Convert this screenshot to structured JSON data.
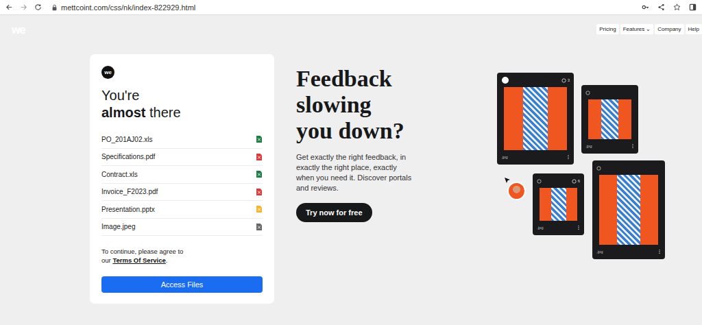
{
  "browser": {
    "url": "mettcoint.com/css/nk/index-822929.html"
  },
  "brand": {
    "logo": "we"
  },
  "nav": [
    {
      "label": "Pricing",
      "caret": ""
    },
    {
      "label": "Features",
      "caret": "⌄"
    },
    {
      "label": "Company",
      "caret": ""
    },
    {
      "label": "Help",
      "caret": ""
    }
  ],
  "card": {
    "logo": "we",
    "title_lead": "You're",
    "title_bold": "almost",
    "title_rest": "there",
    "files": [
      {
        "name": "PO_201AJ02.xls",
        "color": "#1e7b45"
      },
      {
        "name": "Specifications.pdf",
        "color": "#d63b3b"
      },
      {
        "name": "Contract.xls",
        "color": "#1e7b45"
      },
      {
        "name": "Invoice_F2023.pdf",
        "color": "#d63b3b"
      },
      {
        "name": "Presentation.pptx",
        "color": "#f2b632"
      },
      {
        "name": "Image.jpeg",
        "color": "#666666"
      }
    ],
    "consent_text": "To continue, please agree to our",
    "consent_link": "Terms Of Service",
    "consent_end": ".",
    "button": "Access Files"
  },
  "hero": {
    "headline": [
      "Feedback",
      "slowing",
      "you down?"
    ],
    "body": "Get exactly the right feedback, in exactly the right place, exactly when you need it. Discover portals and reviews.",
    "cta": "Try now for free"
  },
  "gallery": [
    {
      "label": ".jpg",
      "count": "3"
    },
    {
      "label": ".jpg"
    },
    {
      "label": ".jpg",
      "count": "6"
    },
    {
      "label": ".jpg"
    }
  ]
}
